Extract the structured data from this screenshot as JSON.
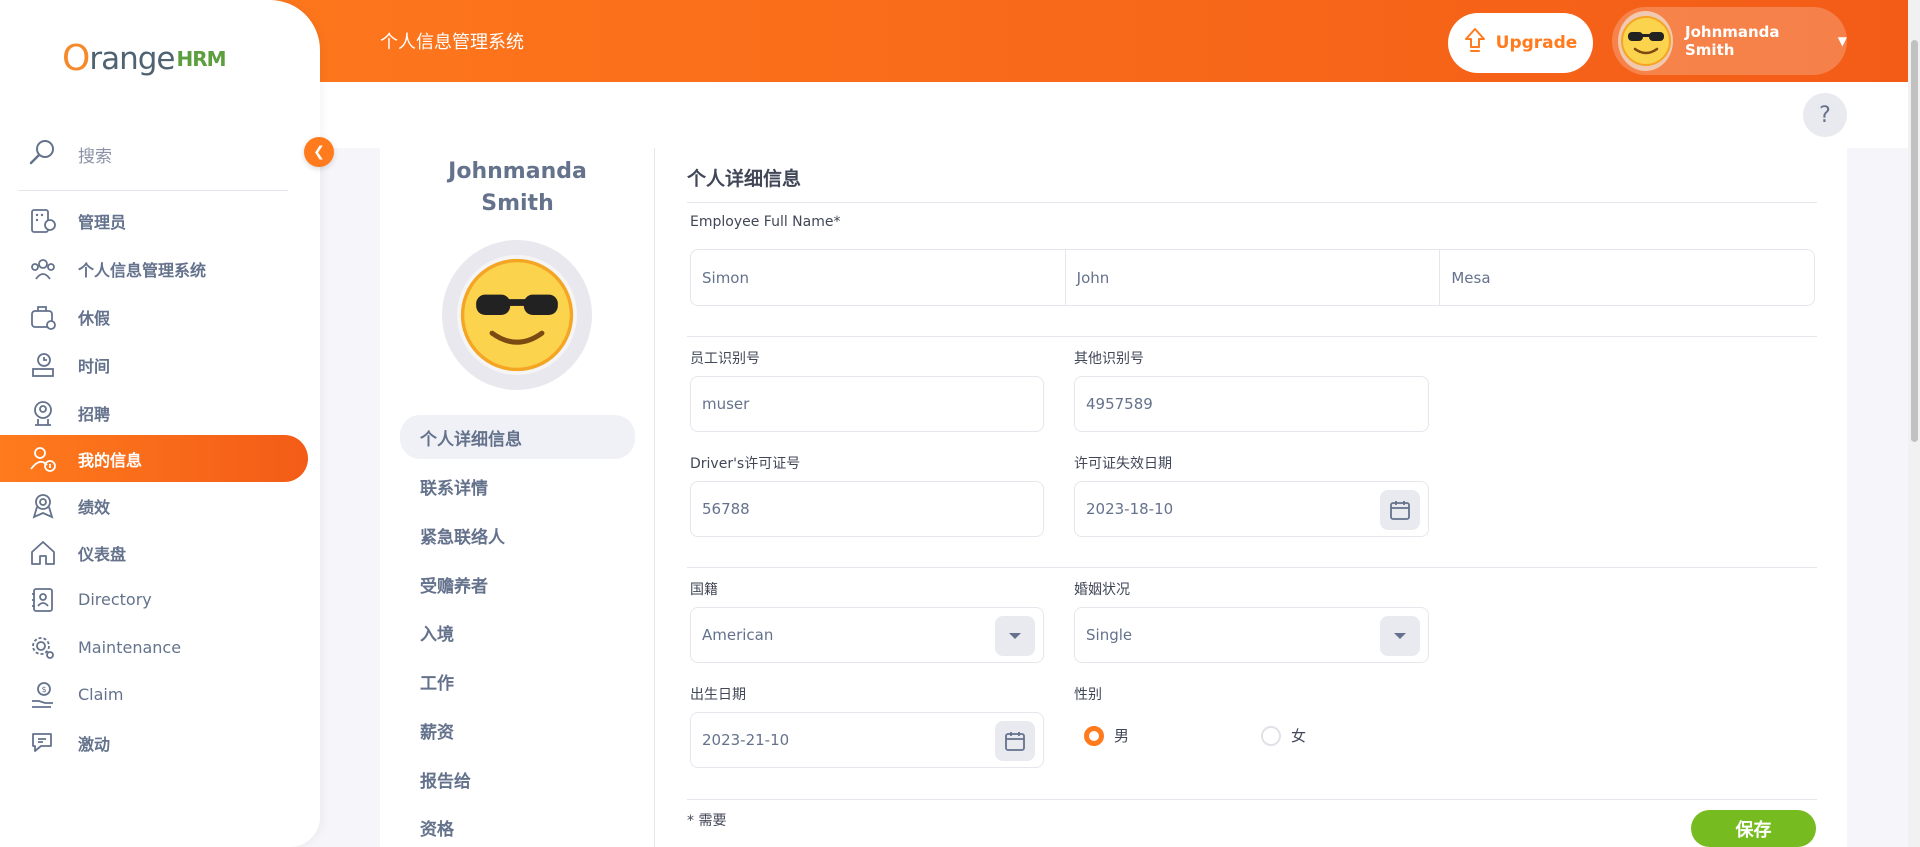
{
  "header": {
    "title": "个人信息管理系统",
    "upgrade_label": "Upgrade",
    "user_name": "Johnmanda Smith",
    "help_label": "?"
  },
  "sidebar": {
    "logo_prefix": "O",
    "logo_mid": "range",
    "logo_suffix": "HRM",
    "search_label": "搜索",
    "items": [
      {
        "label": "管理员",
        "icon": "admin-icon"
      },
      {
        "label": "个人信息管理系统",
        "icon": "pim-icon"
      },
      {
        "label": "休假",
        "icon": "leave-icon"
      },
      {
        "label": "时间",
        "icon": "time-icon"
      },
      {
        "label": "招聘",
        "icon": "recruitment-icon"
      },
      {
        "label": "我的信息",
        "icon": "my-info-icon",
        "active": true
      },
      {
        "label": "绩效",
        "icon": "performance-icon"
      },
      {
        "label": "仪表盘",
        "icon": "dashboard-icon"
      },
      {
        "label": "Directory",
        "icon": "directory-icon"
      },
      {
        "label": "Maintenance",
        "icon": "maintenance-icon"
      },
      {
        "label": "Claim",
        "icon": "claim-icon"
      },
      {
        "label": "激动",
        "icon": "buzz-icon"
      }
    ]
  },
  "profile": {
    "name_line1": "Johnmanda",
    "name_line2": "Smith",
    "tabs": [
      "个人详细信息",
      "联系详情",
      "紧急联络人",
      "受赡养者",
      "入境",
      "工作",
      "薪资",
      "报告给",
      "资格"
    ]
  },
  "form": {
    "section_title": "个人详细信息",
    "full_name_label": "Employee Full Name*",
    "first_name": "Simon",
    "middle_name": "John",
    "last_name": "Mesa",
    "employee_id_label": "员工识别号",
    "employee_id": "muser",
    "other_id_label": "其他识别号",
    "other_id": "4957589",
    "license_label": "Driver's许可证号",
    "license": "56788",
    "license_expiry_label": "许可证失效日期",
    "license_expiry": "2023-18-10",
    "nationality_label": "国籍",
    "nationality": "American",
    "marital_label": "婚姻状况",
    "marital": "Single",
    "dob_label": "出生日期",
    "dob": "2023-21-10",
    "gender_label": "性别",
    "gender_male": "男",
    "gender_female": "女",
    "gender_selected": "男",
    "required_note": "* 需要",
    "save_label": "保存"
  },
  "colors": {
    "brand_orange": "#ff7b1d",
    "save_green": "#76bc21"
  }
}
